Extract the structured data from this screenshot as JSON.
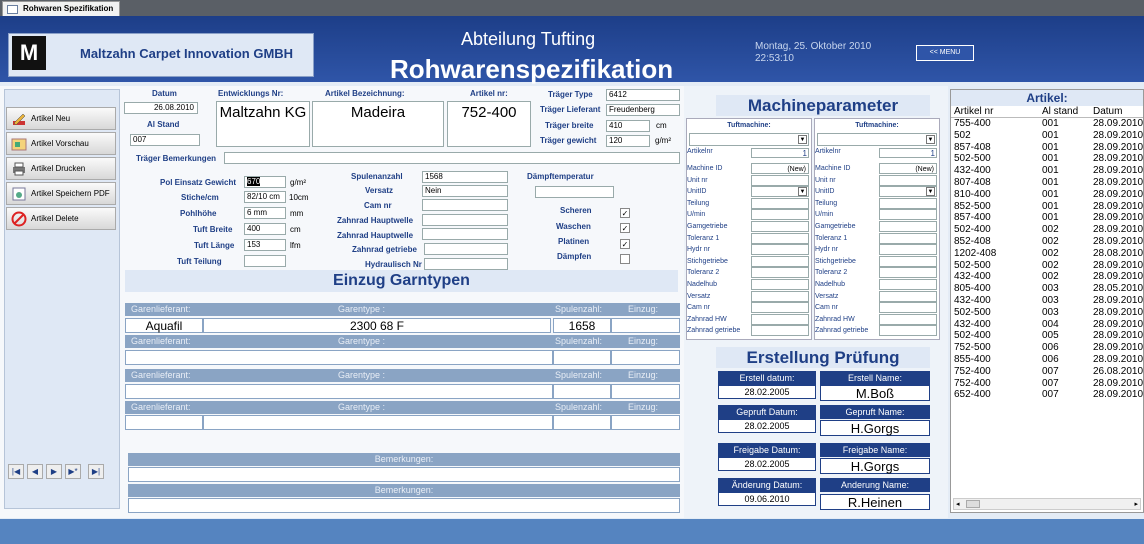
{
  "window": {
    "tab": "Rohwaren Spezifikation"
  },
  "header": {
    "logo": "M",
    "company": "Maltzahn Carpet Innovation GMBH",
    "department": "Abteilung Tufting",
    "title": "Rohwarenspezifikation",
    "date": "Montag, 25. Oktober 2010",
    "time": "22:53:10",
    "menu": "<< MENU"
  },
  "sidebar": {
    "items": [
      "Artikel Neu",
      "Artikel Vorschau",
      "Artikel Drucken",
      "Artikel Speichern PDF",
      "Artikel Delete"
    ]
  },
  "form": {
    "datum_label": "Datum",
    "datum": "26.08.2010",
    "al_stand_label": "Al Stand",
    "al_stand": "007",
    "entw_label": "Entwicklungs Nr:",
    "entw": "Maltzahn KG",
    "bez_label": "Artikel Bezeichnung:",
    "bez": "Madeira",
    "artnr_label": "Artikel nr:",
    "artnr": "752-400",
    "traeger_type_label": "Träger Type",
    "traeger_type": "6412",
    "traeger_lief_label": "Träger Lieferant",
    "traeger_lief": "Freudenberg",
    "traeger_breite_label": "Träger breite",
    "traeger_breite": "410",
    "traeger_breite_unit": "cm",
    "traeger_gewicht_label": "Träger gewicht",
    "traeger_gewicht": "120",
    "traeger_gewicht_unit": "g/m²",
    "traeger_bem_label": "Träger Bemerkungen",
    "pol_label": "Pol Einsatz Gewicht",
    "pol": "670",
    "pol_unit": "g/m²",
    "stiche_label": "Stiche/cm",
    "stiche": "82/10 cm",
    "stiche_unit": "10cm",
    "pohl_label": "Pohlhöhe",
    "pohl": "6 mm",
    "pohl_unit": "mm",
    "tuftb_label": "Tuft Breite",
    "tuftb": "400",
    "tuftb_unit": "cm",
    "tuftl_label": "Tuft Länge",
    "tuftl": "153",
    "tuftl_unit": "lfm",
    "tuftt_label": "Tuft Teilung",
    "spulen_label": "Spulenanzahl",
    "spulen": "1568",
    "versatz_label": "Versatz",
    "versatz": "Nein",
    "cam_label": "Cam nr",
    "zhw1_label": "Zahnrad Hauptwelle",
    "zhw2_label": "Zahnrad Hauptwelle",
    "zget_label": "Zahnrad getriebe",
    "hydr_label": "Hydraulisch Nr",
    "daempf_label": "Dämpftemperatur",
    "scheren_label": "Scheren",
    "waschen_label": "Waschen",
    "platinen_label": "Platinen",
    "daempfen_label": "Dämpfen",
    "check": "✓"
  },
  "einzug": {
    "title": "Einzug Garntypen",
    "h_lief": "Garenlieferant:",
    "h_typ": "Garentype :",
    "h_spul": "Spulenzahl:",
    "h_einzug": "Einzug:",
    "row1": {
      "lief": "Aquafil",
      "typ": "2300 68 F",
      "spul": "1658"
    },
    "bemerk": "Bemerkungen:"
  },
  "machine": {
    "title": "Machineparameter",
    "tuft": "Tuftmachine:",
    "artikelnr": "Artikelnr",
    "one": "1",
    "new": "(New)",
    "labels": [
      "Machine ID",
      "Unit nr",
      "UnitID",
      "Teilung",
      "U/min",
      "Gamgetriebe",
      "Toleranz 1",
      "Hydr nr",
      "Stichgetriebe",
      "Toleranz 2",
      "Nadelhub",
      "Versatz",
      "Cam nr",
      "Zahnrad HW",
      "Zahnrad getriebe"
    ]
  },
  "erstellung": {
    "title": "Erstellung  Prüfung",
    "erstell_datum_l": "Erstell datum:",
    "erstell_datum": "28.02.2005",
    "erstell_name_l": "Erstell Name:",
    "erstell_name": "M.Boß",
    "gepr_datum_l": "Gepruft Datum:",
    "gepr_datum": "28.02.2005",
    "gepr_name_l": "Gepruft Name:",
    "gepr_name": "H.Gorgs",
    "frei_datum_l": "Freigabe Datum:",
    "frei_datum": "28.02.2005",
    "frei_name_l": "Freigabe Name:",
    "frei_name": "H.Gorgs",
    "aend_datum_l": "Änderung Datum:",
    "aend_datum": "09.06.2010",
    "aend_name_l": "Anderung Name:",
    "aend_name": "R.Heinen"
  },
  "artikel": {
    "title": "Artikel:",
    "cols": [
      "Artikel nr",
      "Al stand",
      "Datum"
    ],
    "rows": [
      [
        "755-400",
        "001",
        "28.09.2010"
      ],
      [
        "502",
        "001",
        "28.09.2010"
      ],
      [
        "857-408",
        "001",
        "28.09.2010"
      ],
      [
        "502-500",
        "001",
        "28.09.2010"
      ],
      [
        "432-400",
        "001",
        "28.09.2010"
      ],
      [
        "807-408",
        "001",
        "28.09.2010"
      ],
      [
        "810-400",
        "001",
        "28.09.2010"
      ],
      [
        "852-500",
        "001",
        "28.09.2010"
      ],
      [
        "857-400",
        "001",
        "28.09.2010"
      ],
      [
        "502-400",
        "002",
        "28.09.2010"
      ],
      [
        "852-408",
        "002",
        "28.09.2010"
      ],
      [
        "1202-408",
        "002",
        "28.08.2010"
      ],
      [
        "502-500",
        "002",
        "28.09.2010"
      ],
      [
        "432-400",
        "002",
        "28.09.2010"
      ],
      [
        "805-400",
        "003",
        "28.05.2010"
      ],
      [
        "432-400",
        "003",
        "28.09.2010"
      ],
      [
        "502-500",
        "003",
        "28.09.2010"
      ],
      [
        "432-400",
        "004",
        "28.09.2010"
      ],
      [
        "502-400",
        "005",
        "28.09.2010"
      ],
      [
        "752-500",
        "006",
        "28.09.2010"
      ],
      [
        "855-400",
        "006",
        "28.09.2010"
      ],
      [
        "752-400",
        "007",
        "26.08.2010"
      ],
      [
        "752-400",
        "007",
        "28.09.2010"
      ],
      [
        "652-400",
        "007",
        "28.09.2010"
      ]
    ]
  },
  "colors": {
    "navy": "#1f3f86",
    "header": "#2f55a8",
    "bar": "#8aa4c4"
  }
}
